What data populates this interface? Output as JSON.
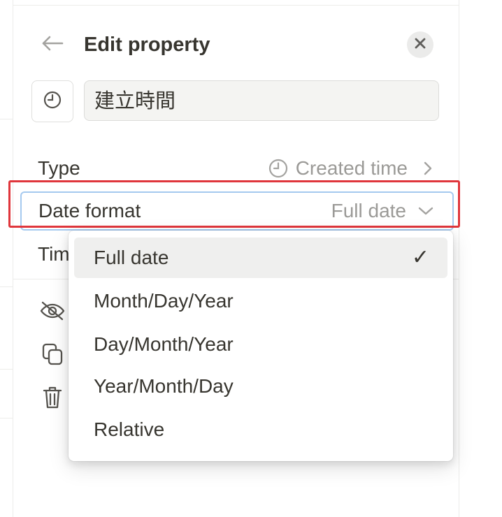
{
  "header": {
    "title": "Edit property",
    "back_icon": "arrow-left-icon",
    "close_icon": "close-icon"
  },
  "property": {
    "icon": "clock-icon",
    "name": "建立時間"
  },
  "rows": {
    "type": {
      "label": "Type",
      "value": "Created time",
      "value_icon": "clock-icon"
    },
    "date_format": {
      "label": "Date format",
      "value": "Full date"
    },
    "time_format": {
      "label": "Tim"
    }
  },
  "actions": [
    {
      "icon": "eye-off-icon"
    },
    {
      "icon": "duplicate-icon"
    },
    {
      "icon": "trash-icon"
    }
  ],
  "dropdown": {
    "options": [
      {
        "label": "Full date",
        "selected": true,
        "check": "✓"
      },
      {
        "label": "Month/Day/Year"
      },
      {
        "label": "Day/Month/Year"
      },
      {
        "label": "Year/Month/Day"
      },
      {
        "label": "Relative"
      }
    ]
  },
  "colors": {
    "highlight": "#e0363c",
    "focus_border": "#a5c9ef",
    "text": "#37352f",
    "muted": "#9b9a97"
  }
}
